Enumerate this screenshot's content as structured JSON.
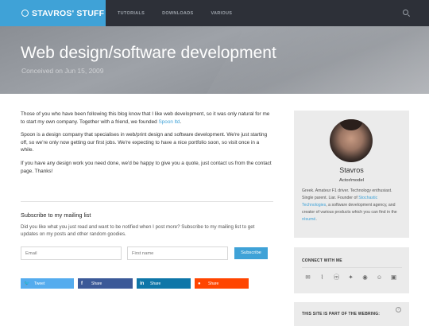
{
  "header": {
    "brand": "STAVROS' STUFF",
    "nav": [
      "TUTORIALS",
      "DOWNLOADS",
      "VARIOUS"
    ]
  },
  "hero": {
    "title": "Web design/software development",
    "subtitle": "Conceived on Jun 15, 2009"
  },
  "post": {
    "p1_before": "Those of you who have been following this blog know that I like web development, so it was only natural for me to start my own company. Together with a friend, we founded ",
    "p1_link": "Spoon ltd",
    "p1_after": ".",
    "p2": "Spoon is a design company that specialises in web/print design and software development. We're just starting off, so we're only now getting our first jobs. We're expecting to have a nice portfolio soon, so visit once in a while.",
    "p3": "If you have any design work you need done, we'd be happy to give you a quote, just contact us from the contact page. Thanks!"
  },
  "subscribe": {
    "title": "Subscribe to my mailing list",
    "description": "Did you like what you just read and want to be notified when I post more? Subscribe to my mailing list to get updates on my posts and other random goodies.",
    "email_placeholder": "Email",
    "name_placeholder": "First name",
    "button": "Subscribe"
  },
  "share": {
    "twitter": "Tweet",
    "facebook": "Share",
    "linkedin": "Share",
    "reddit": "Share"
  },
  "profile": {
    "name": "Stavros",
    "role": "Actor/model",
    "bio_before": "Greek. Amateur F1 driver. Technology enthusiast. Single parent. Liar. Founder of ",
    "bio_link1": "Stochastic Technologies",
    "bio_middle": ", a software development agency, and creator of various products which you can find in the ",
    "bio_link2": "résumé",
    "bio_after": "."
  },
  "connect": {
    "title": "CONNECT WITH ME",
    "icons": [
      "email-icon",
      "rss-icon",
      "mastodon-icon",
      "twitter-icon",
      "github-icon",
      "discord-icon",
      "other-icon"
    ]
  },
  "webring": {
    "title": "THIS SITE IS PART OF THE WEBRING:"
  },
  "colors": {
    "accent": "#3fa2d7",
    "topbar": "#2d3038"
  }
}
